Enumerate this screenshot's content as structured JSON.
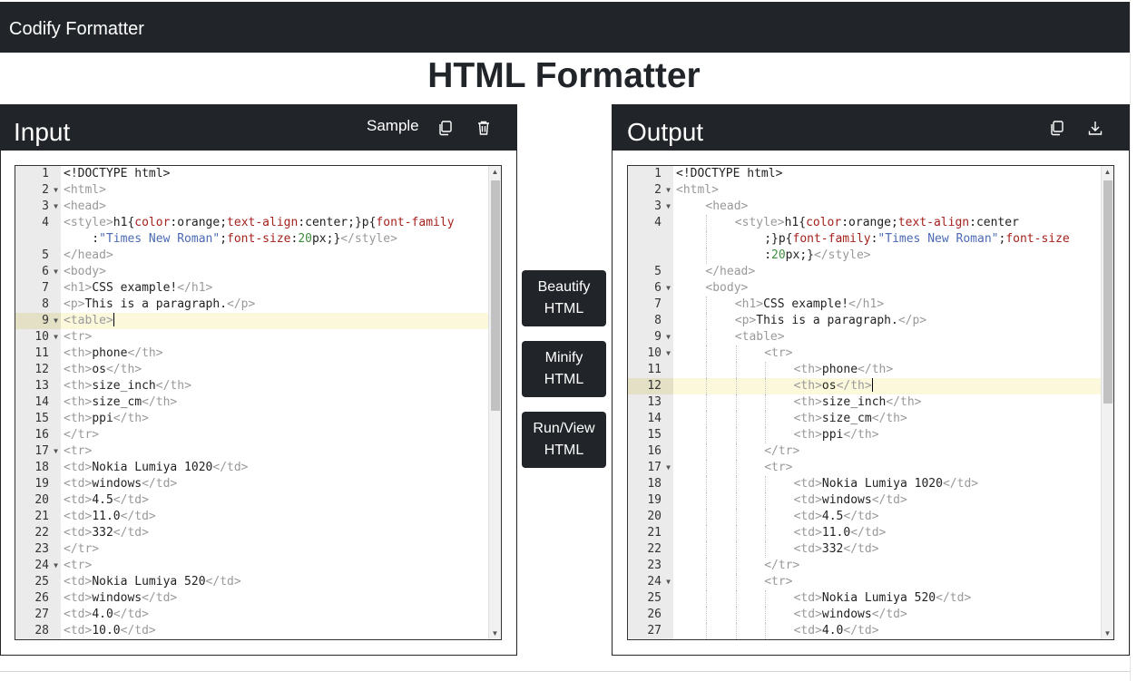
{
  "app": {
    "brand": "Codify Formatter",
    "page_title": "HTML Formatter"
  },
  "input_panel": {
    "title": "Input",
    "sample_label": "Sample",
    "copy_icon": "copy-icon",
    "delete_icon": "trash-icon",
    "active_line": 9,
    "lines": [
      {
        "n": "1",
        "fold": false,
        "segs": [
          [
            "text",
            "<!DOCTYPE html>"
          ]
        ]
      },
      {
        "n": "2",
        "fold": true,
        "segs": [
          [
            "tag",
            "<html>"
          ]
        ]
      },
      {
        "n": "3",
        "fold": true,
        "segs": [
          [
            "tag",
            "<head>"
          ]
        ]
      },
      {
        "n": "4",
        "fold": false,
        "segs": [
          [
            "tag",
            "<style>"
          ],
          [
            "text",
            "h1{"
          ],
          [
            "prop",
            "color"
          ],
          [
            "text",
            ":orange;"
          ],
          [
            "prop",
            "text-align"
          ],
          [
            "text",
            ":center;}p{"
          ],
          [
            "prop",
            "font-family"
          ]
        ]
      },
      {
        "n": "",
        "fold": false,
        "segs": [
          [
            "text",
            "    :"
          ],
          [
            "str",
            "\"Times New Roman\""
          ],
          [
            "text",
            ";"
          ],
          [
            "prop",
            "font-size"
          ],
          [
            "text",
            ":"
          ],
          [
            "num",
            "20"
          ],
          [
            "text",
            "px;}"
          ],
          [
            "tag",
            "</style>"
          ]
        ]
      },
      {
        "n": "5",
        "fold": false,
        "segs": [
          [
            "tag",
            "</head>"
          ]
        ]
      },
      {
        "n": "6",
        "fold": true,
        "segs": [
          [
            "tag",
            "<body>"
          ]
        ]
      },
      {
        "n": "7",
        "fold": false,
        "segs": [
          [
            "tag",
            "<h1>"
          ],
          [
            "text",
            "CSS example!"
          ],
          [
            "tag",
            "</h1>"
          ]
        ]
      },
      {
        "n": "8",
        "fold": false,
        "segs": [
          [
            "tag",
            "<p>"
          ],
          [
            "text",
            "This is a paragraph."
          ],
          [
            "tag",
            "</p>"
          ]
        ]
      },
      {
        "n": "9",
        "fold": true,
        "active": true,
        "segs": [
          [
            "tag",
            "<table>"
          ]
        ]
      },
      {
        "n": "10",
        "fold": true,
        "segs": [
          [
            "tag",
            "<tr>"
          ]
        ]
      },
      {
        "n": "11",
        "fold": false,
        "segs": [
          [
            "tag",
            "<th>"
          ],
          [
            "text",
            "phone"
          ],
          [
            "tag",
            "</th>"
          ]
        ]
      },
      {
        "n": "12",
        "fold": false,
        "segs": [
          [
            "tag",
            "<th>"
          ],
          [
            "text",
            "os"
          ],
          [
            "tag",
            "</th>"
          ]
        ]
      },
      {
        "n": "13",
        "fold": false,
        "segs": [
          [
            "tag",
            "<th>"
          ],
          [
            "text",
            "size_inch"
          ],
          [
            "tag",
            "</th>"
          ]
        ]
      },
      {
        "n": "14",
        "fold": false,
        "segs": [
          [
            "tag",
            "<th>"
          ],
          [
            "text",
            "size_cm"
          ],
          [
            "tag",
            "</th>"
          ]
        ]
      },
      {
        "n": "15",
        "fold": false,
        "segs": [
          [
            "tag",
            "<th>"
          ],
          [
            "text",
            "ppi"
          ],
          [
            "tag",
            "</th>"
          ]
        ]
      },
      {
        "n": "16",
        "fold": false,
        "segs": [
          [
            "tag",
            "</tr>"
          ]
        ]
      },
      {
        "n": "17",
        "fold": true,
        "segs": [
          [
            "tag",
            "<tr>"
          ]
        ]
      },
      {
        "n": "18",
        "fold": false,
        "segs": [
          [
            "tag",
            "<td>"
          ],
          [
            "text",
            "Nokia Lumiya 1020"
          ],
          [
            "tag",
            "</td>"
          ]
        ]
      },
      {
        "n": "19",
        "fold": false,
        "segs": [
          [
            "tag",
            "<td>"
          ],
          [
            "text",
            "windows"
          ],
          [
            "tag",
            "</td>"
          ]
        ]
      },
      {
        "n": "20",
        "fold": false,
        "segs": [
          [
            "tag",
            "<td>"
          ],
          [
            "text",
            "4.5"
          ],
          [
            "tag",
            "</td>"
          ]
        ]
      },
      {
        "n": "21",
        "fold": false,
        "segs": [
          [
            "tag",
            "<td>"
          ],
          [
            "text",
            "11.0"
          ],
          [
            "tag",
            "</td>"
          ]
        ]
      },
      {
        "n": "22",
        "fold": false,
        "segs": [
          [
            "tag",
            "<td>"
          ],
          [
            "text",
            "332"
          ],
          [
            "tag",
            "</td>"
          ]
        ]
      },
      {
        "n": "23",
        "fold": false,
        "segs": [
          [
            "tag",
            "</tr>"
          ]
        ]
      },
      {
        "n": "24",
        "fold": true,
        "segs": [
          [
            "tag",
            "<tr>"
          ]
        ]
      },
      {
        "n": "25",
        "fold": false,
        "segs": [
          [
            "tag",
            "<td>"
          ],
          [
            "text",
            "Nokia Lumiya 520"
          ],
          [
            "tag",
            "</td>"
          ]
        ]
      },
      {
        "n": "26",
        "fold": false,
        "segs": [
          [
            "tag",
            "<td>"
          ],
          [
            "text",
            "windows"
          ],
          [
            "tag",
            "</td>"
          ]
        ]
      },
      {
        "n": "27",
        "fold": false,
        "segs": [
          [
            "tag",
            "<td>"
          ],
          [
            "text",
            "4.0"
          ],
          [
            "tag",
            "</td>"
          ]
        ]
      },
      {
        "n": "28",
        "fold": false,
        "segs": [
          [
            "tag",
            "<td>"
          ],
          [
            "text",
            "10.0"
          ],
          [
            "tag",
            "</td>"
          ]
        ]
      }
    ]
  },
  "actions": {
    "beautify": [
      "Beautify",
      "HTML"
    ],
    "minify": [
      "Minify",
      "HTML"
    ],
    "run": [
      "Run/View",
      "HTML"
    ]
  },
  "output_panel": {
    "title": "Output",
    "copy_icon": "copy-icon",
    "download_icon": "download-icon",
    "active_line": 12,
    "lines": [
      {
        "n": "1",
        "fold": false,
        "ind": 0,
        "segs": [
          [
            "text",
            "<!DOCTYPE html>"
          ]
        ]
      },
      {
        "n": "2",
        "fold": true,
        "ind": 0,
        "segs": [
          [
            "tag",
            "<html>"
          ]
        ]
      },
      {
        "n": "3",
        "fold": true,
        "ind": 1,
        "segs": [
          [
            "tag",
            "<head>"
          ]
        ]
      },
      {
        "n": "4",
        "fold": false,
        "ind": 2,
        "segs": [
          [
            "tag",
            "<style>"
          ],
          [
            "text",
            "h1{"
          ],
          [
            "prop",
            "color"
          ],
          [
            "text",
            ":orange;"
          ],
          [
            "prop",
            "text-align"
          ],
          [
            "text",
            ":center"
          ]
        ]
      },
      {
        "n": "",
        "fold": false,
        "ind": 2,
        "cont": true,
        "segs": [
          [
            "text",
            ";}p{"
          ],
          [
            "prop",
            "font-family"
          ],
          [
            "text",
            ":"
          ],
          [
            "str",
            "\"Times New Roman\""
          ],
          [
            "text",
            ";"
          ],
          [
            "prop",
            "font-size"
          ]
        ]
      },
      {
        "n": "",
        "fold": false,
        "ind": 2,
        "cont": true,
        "segs": [
          [
            "text",
            ":"
          ],
          [
            "num",
            "20"
          ],
          [
            "text",
            "px;}"
          ],
          [
            "tag",
            "</style>"
          ]
        ]
      },
      {
        "n": "5",
        "fold": false,
        "ind": 1,
        "segs": [
          [
            "tag",
            "</head>"
          ]
        ]
      },
      {
        "n": "6",
        "fold": true,
        "ind": 1,
        "segs": [
          [
            "tag",
            "<body>"
          ]
        ]
      },
      {
        "n": "7",
        "fold": false,
        "ind": 2,
        "segs": [
          [
            "tag",
            "<h1>"
          ],
          [
            "text",
            "CSS example!"
          ],
          [
            "tag",
            "</h1>"
          ]
        ]
      },
      {
        "n": "8",
        "fold": false,
        "ind": 2,
        "segs": [
          [
            "tag",
            "<p>"
          ],
          [
            "text",
            "This is a paragraph."
          ],
          [
            "tag",
            "</p>"
          ]
        ]
      },
      {
        "n": "9",
        "fold": true,
        "ind": 2,
        "segs": [
          [
            "tag",
            "<table>"
          ]
        ]
      },
      {
        "n": "10",
        "fold": true,
        "ind": 3,
        "segs": [
          [
            "tag",
            "<tr>"
          ]
        ]
      },
      {
        "n": "11",
        "fold": false,
        "ind": 4,
        "segs": [
          [
            "tag",
            "<th>"
          ],
          [
            "text",
            "phone"
          ],
          [
            "tag",
            "</th>"
          ]
        ]
      },
      {
        "n": "12",
        "fold": false,
        "ind": 4,
        "active": true,
        "segs": [
          [
            "tag",
            "<th>"
          ],
          [
            "text",
            "os"
          ],
          [
            "tag",
            "</th>"
          ]
        ]
      },
      {
        "n": "13",
        "fold": false,
        "ind": 4,
        "segs": [
          [
            "tag",
            "<th>"
          ],
          [
            "text",
            "size_inch"
          ],
          [
            "tag",
            "</th>"
          ]
        ]
      },
      {
        "n": "14",
        "fold": false,
        "ind": 4,
        "segs": [
          [
            "tag",
            "<th>"
          ],
          [
            "text",
            "size_cm"
          ],
          [
            "tag",
            "</th>"
          ]
        ]
      },
      {
        "n": "15",
        "fold": false,
        "ind": 4,
        "segs": [
          [
            "tag",
            "<th>"
          ],
          [
            "text",
            "ppi"
          ],
          [
            "tag",
            "</th>"
          ]
        ]
      },
      {
        "n": "16",
        "fold": false,
        "ind": 3,
        "segs": [
          [
            "tag",
            "</tr>"
          ]
        ]
      },
      {
        "n": "17",
        "fold": true,
        "ind": 3,
        "segs": [
          [
            "tag",
            "<tr>"
          ]
        ]
      },
      {
        "n": "18",
        "fold": false,
        "ind": 4,
        "segs": [
          [
            "tag",
            "<td>"
          ],
          [
            "text",
            "Nokia Lumiya 1020"
          ],
          [
            "tag",
            "</td>"
          ]
        ]
      },
      {
        "n": "19",
        "fold": false,
        "ind": 4,
        "segs": [
          [
            "tag",
            "<td>"
          ],
          [
            "text",
            "windows"
          ],
          [
            "tag",
            "</td>"
          ]
        ]
      },
      {
        "n": "20",
        "fold": false,
        "ind": 4,
        "segs": [
          [
            "tag",
            "<td>"
          ],
          [
            "text",
            "4.5"
          ],
          [
            "tag",
            "</td>"
          ]
        ]
      },
      {
        "n": "21",
        "fold": false,
        "ind": 4,
        "segs": [
          [
            "tag",
            "<td>"
          ],
          [
            "text",
            "11.0"
          ],
          [
            "tag",
            "</td>"
          ]
        ]
      },
      {
        "n": "22",
        "fold": false,
        "ind": 4,
        "segs": [
          [
            "tag",
            "<td>"
          ],
          [
            "text",
            "332"
          ],
          [
            "tag",
            "</td>"
          ]
        ]
      },
      {
        "n": "23",
        "fold": false,
        "ind": 3,
        "segs": [
          [
            "tag",
            "</tr>"
          ]
        ]
      },
      {
        "n": "24",
        "fold": true,
        "ind": 3,
        "segs": [
          [
            "tag",
            "<tr>"
          ]
        ]
      },
      {
        "n": "25",
        "fold": false,
        "ind": 4,
        "segs": [
          [
            "tag",
            "<td>"
          ],
          [
            "text",
            "Nokia Lumiya 520"
          ],
          [
            "tag",
            "</td>"
          ]
        ]
      },
      {
        "n": "26",
        "fold": false,
        "ind": 4,
        "segs": [
          [
            "tag",
            "<td>"
          ],
          [
            "text",
            "windows"
          ],
          [
            "tag",
            "</td>"
          ]
        ]
      },
      {
        "n": "27",
        "fold": false,
        "ind": 4,
        "segs": [
          [
            "tag",
            "<td>"
          ],
          [
            "text",
            "4.0"
          ],
          [
            "tag",
            "</td>"
          ]
        ]
      }
    ]
  }
}
